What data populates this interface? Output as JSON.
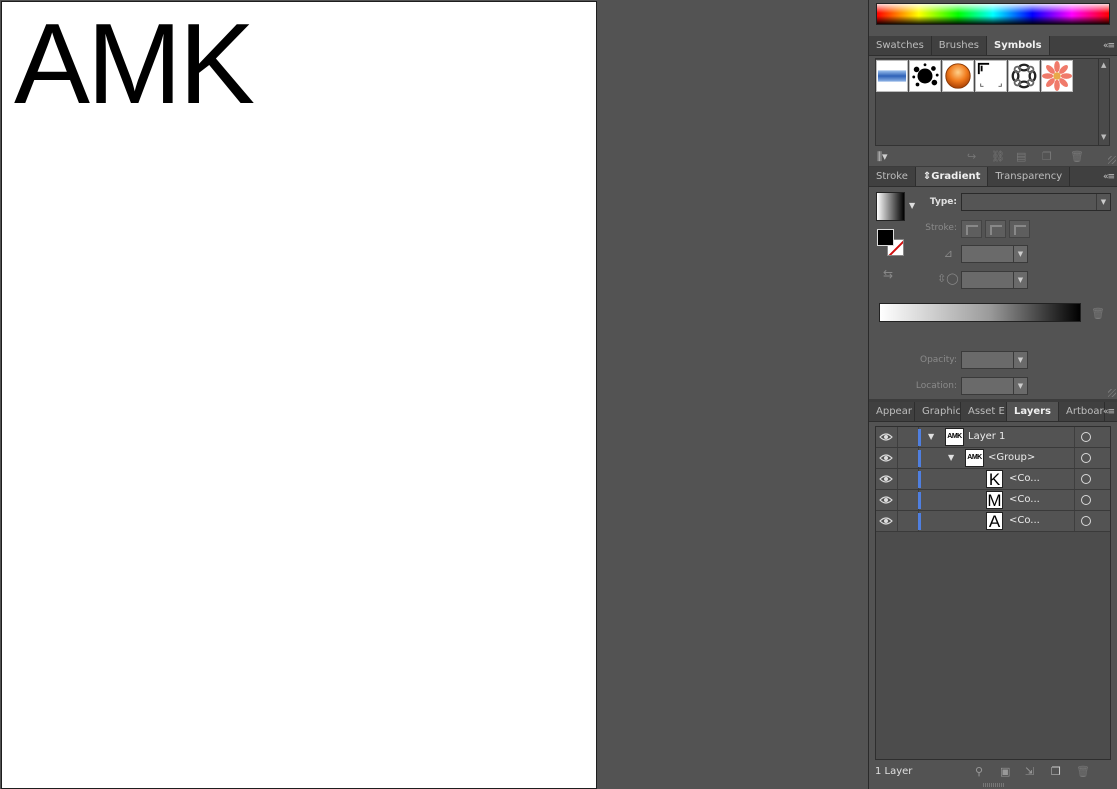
{
  "artboard": {
    "text": "AMK"
  },
  "symbols_panel": {
    "tabs": [
      "Swatches",
      "Brushes",
      "Symbols"
    ],
    "active_tab": "Symbols",
    "symbols": [
      "blue-banner",
      "ink-splatter",
      "orange-button",
      "corner-marks",
      "chain-ring",
      "pink-flower"
    ]
  },
  "gradient_panel": {
    "tabs": [
      "Stroke",
      "Gradient",
      "Transparency"
    ],
    "active_tab": "Gradient",
    "type_label": "Type:",
    "stroke_label": "Stroke:",
    "opacity_label": "Opacity:",
    "location_label": "Location:",
    "gradient_colors": [
      "#ffffff",
      "#000000"
    ]
  },
  "layers_panel": {
    "tabs": [
      "Appear",
      "Graphic",
      "Asset E",
      "Layers",
      "Artboar"
    ],
    "active_tab": "Layers",
    "rows": [
      {
        "thumb": "AMK",
        "name": "Layer 1"
      },
      {
        "thumb": "AMK",
        "name": "<Group>"
      },
      {
        "thumb": "K",
        "name": "<Co..."
      },
      {
        "thumb": "M",
        "name": "<Co..."
      },
      {
        "thumb": "A",
        "name": "<Co..."
      }
    ],
    "layer_count": "1 Layer",
    "layer_color": "#4f7fe0"
  }
}
